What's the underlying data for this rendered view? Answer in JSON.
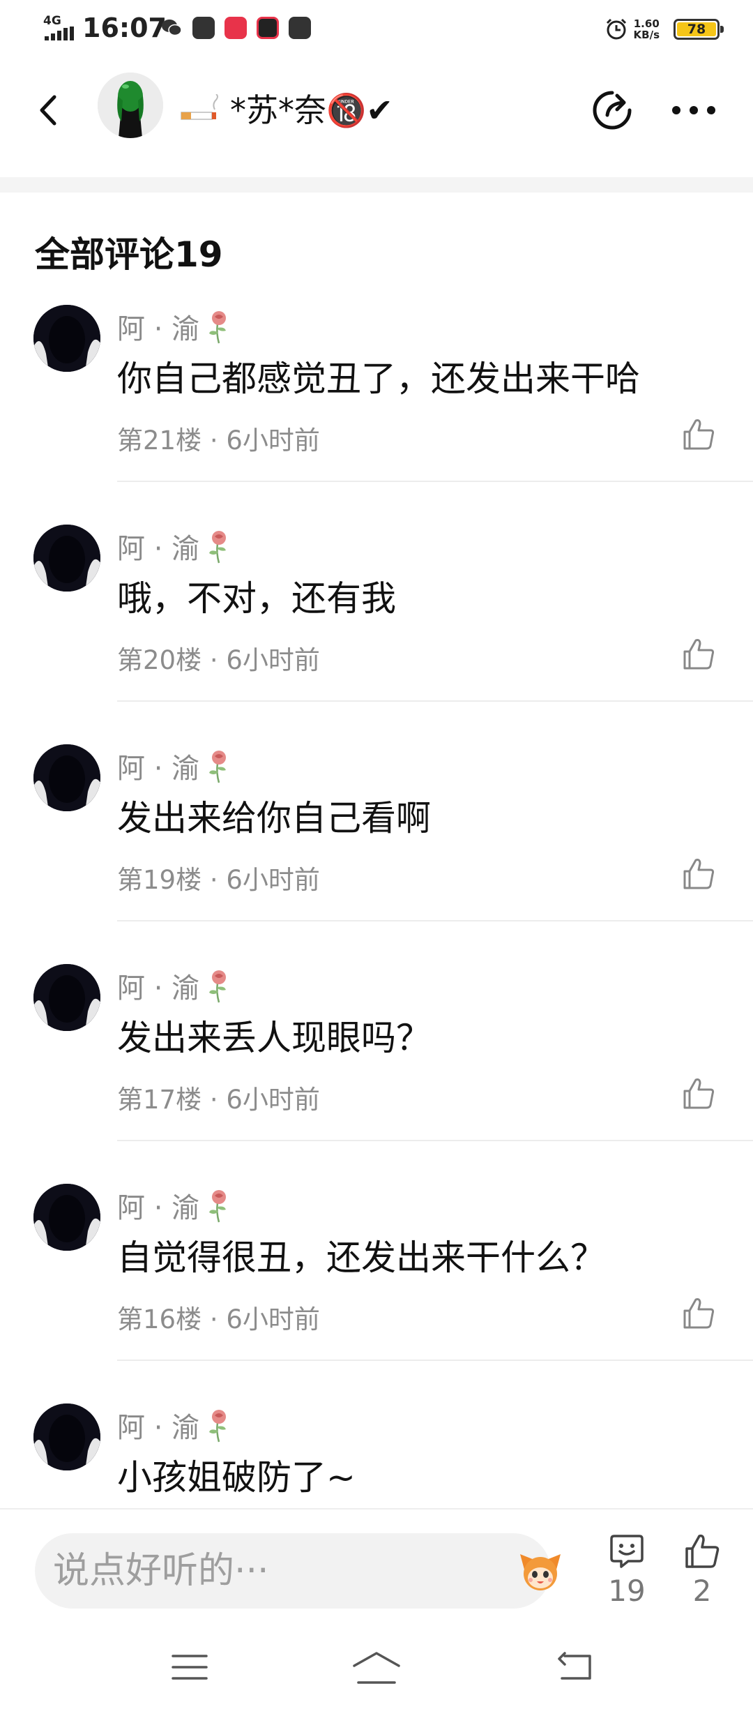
{
  "status_bar": {
    "network": "4G",
    "time": "16:07",
    "speed_value": "1.60",
    "speed_unit": "KB/s",
    "battery": "78"
  },
  "header": {
    "user_name": "*苏*奈🔞✔"
  },
  "comments_section": {
    "title": "全部评论19",
    "comments": [
      {
        "name": "阿 · 渝",
        "text": "你自己都感觉丑了，还发出来干哈",
        "meta": "第21楼 · 6小时前"
      },
      {
        "name": "阿 · 渝",
        "text": "哦，不对，还有我",
        "meta": "第20楼 · 6小时前"
      },
      {
        "name": "阿 · 渝",
        "text": "发出来给你自己看啊",
        "meta": "第19楼 · 6小时前"
      },
      {
        "name": "阿 · 渝",
        "text": "发出来丢人现眼吗？",
        "meta": "第17楼 · 6小时前"
      },
      {
        "name": "阿 · 渝",
        "text": "自觉得很丑，还发出来干什么？",
        "meta": "第16楼 · 6小时前"
      },
      {
        "name": "阿 · 渝",
        "text": "小孩姐破防了~",
        "meta": ""
      }
    ]
  },
  "bottom_bar": {
    "input_placeholder": "说点好听的···",
    "comment_count": "19",
    "like_count": "2"
  },
  "colors": {
    "accent_battery": "#f5c518",
    "muted_text": "#8c8c8c",
    "rose": "#e07a7a"
  },
  "icons": {
    "back": "chevron-left-icon",
    "share": "share-icon",
    "more": "more-icon",
    "like": "thumbs-up-icon",
    "comment": "comment-bubble-icon",
    "nav_menu": "menu-icon",
    "nav_home": "home-icon",
    "nav_back": "back-icon"
  }
}
